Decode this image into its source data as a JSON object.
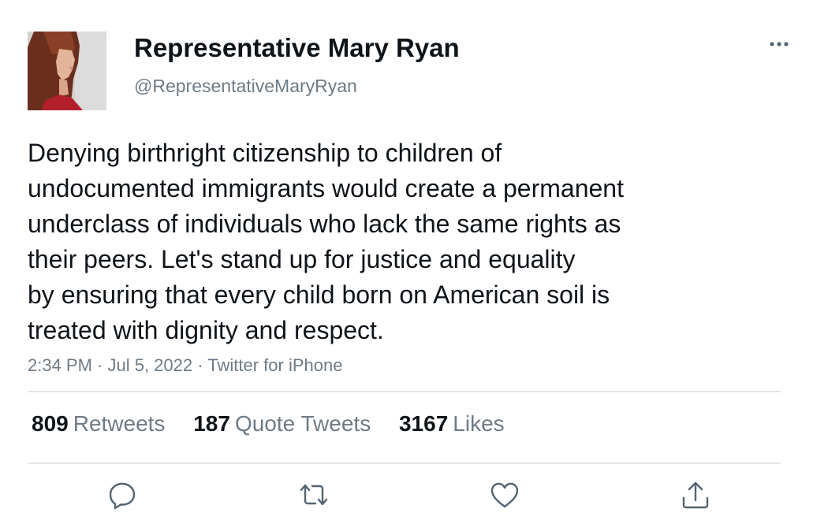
{
  "user": {
    "display_name": "Representative Mary Ryan",
    "handle": "@RepresentativeMaryRyan"
  },
  "tweet": {
    "lines": [
      "Denying birthright citizenship to children of",
      "undocumented immigrants would create a permanent",
      "underclass of individuals who lack the same rights as",
      "their peers. Let's stand up for justice and equality",
      "by ensuring that every child born on American soil is",
      "treated with dignity and respect."
    ],
    "meta": "2:34 PM · Jul 5, 2022 · Twitter for iPhone"
  },
  "stats": {
    "retweets": {
      "count": "809",
      "label": "Retweets"
    },
    "quotes": {
      "count": "187",
      "label": "Quote Tweets"
    },
    "likes": {
      "count": "3167",
      "label": "Likes"
    }
  },
  "icons": {
    "more": "more-horizontal-icon",
    "reply": "reply-icon",
    "retweet": "retweet-icon",
    "like": "heart-icon",
    "share": "share-icon"
  },
  "colors": {
    "text": "#0f1419",
    "secondary": "#6e7b86",
    "divider": "#e1e6ea",
    "icon": "#536471"
  }
}
